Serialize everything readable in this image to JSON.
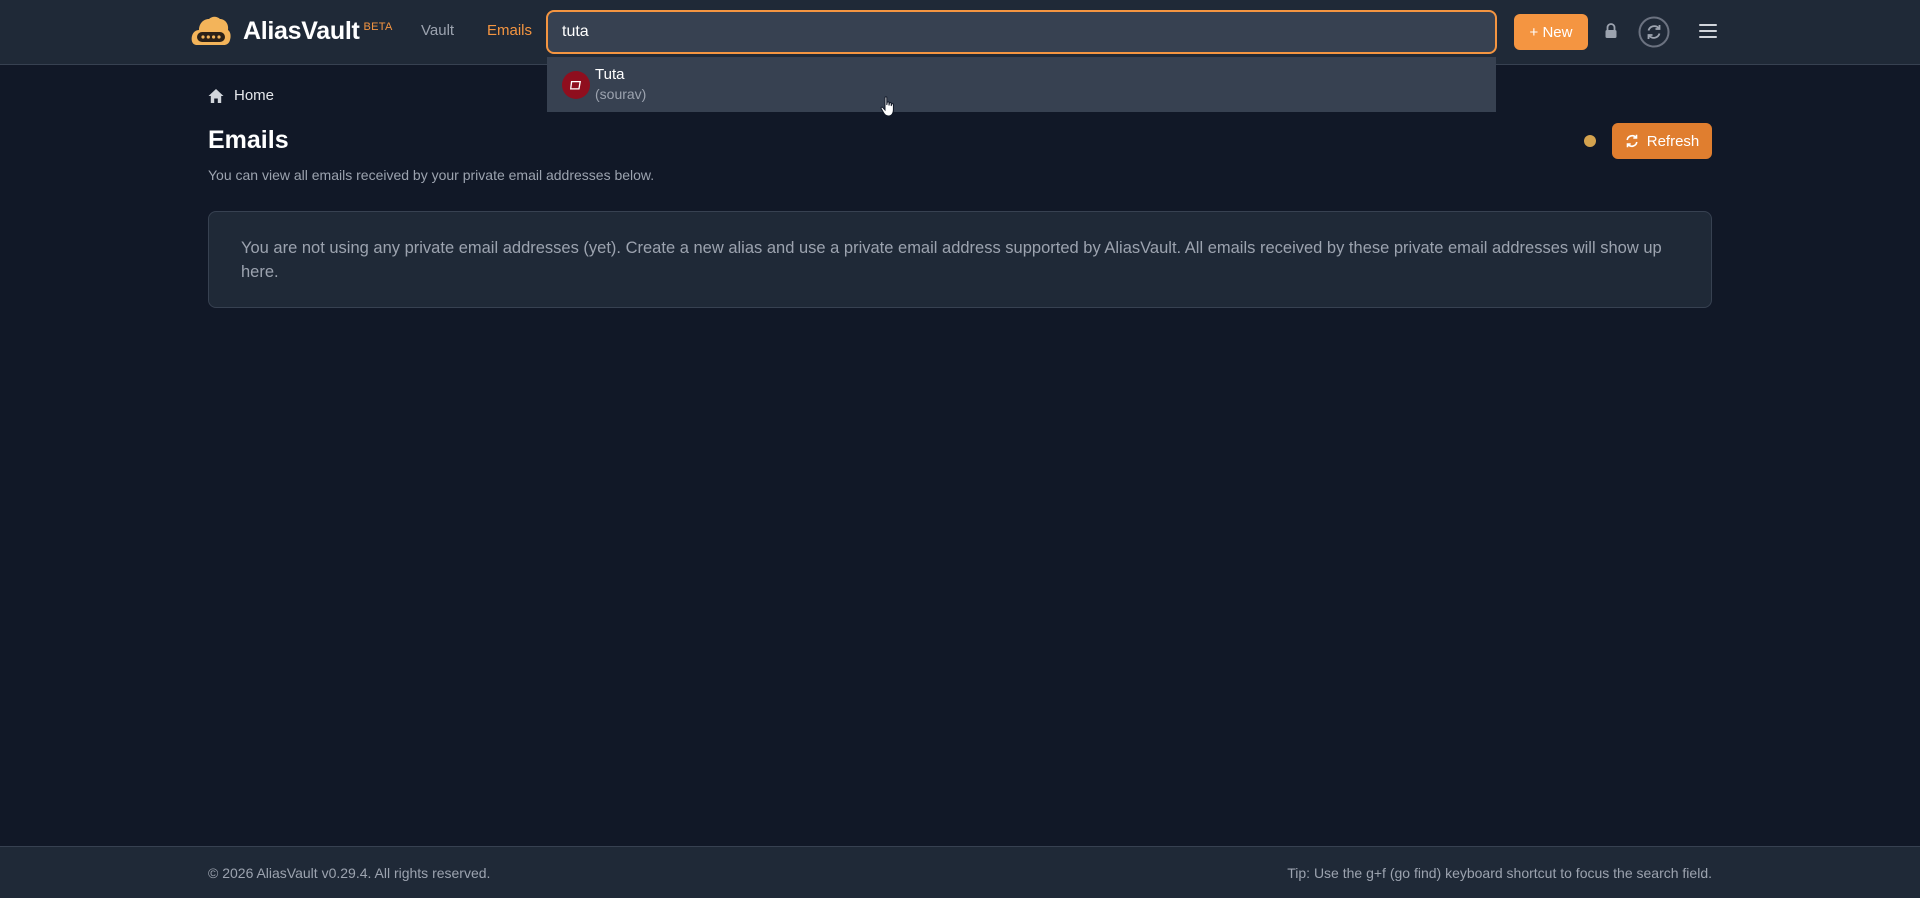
{
  "header": {
    "brand": "AliasVault",
    "badge": "BETA",
    "nav": {
      "vault": "Vault",
      "emails": "Emails"
    },
    "search_value": "tuta",
    "new_button": "+ New"
  },
  "search_results": [
    {
      "name": "Tuta",
      "username": "(sourav)"
    }
  ],
  "breadcrumb": {
    "home": "Home"
  },
  "page": {
    "title": "Emails",
    "subtitle": "You can view all emails received by your private email addresses below.",
    "refresh": "Refresh",
    "notice": "You are not using any private email addresses (yet). Create a new alias and use a private email address supported by AliasVault. All emails received by these private email addresses will show up here."
  },
  "footer": {
    "copyright": "© 2026 AliasVault v0.29.4. All rights reserved.",
    "tip": "Tip: Use the g+f (go find) keyboard shortcut to focus the search field."
  },
  "colors": {
    "accent": "#f49541",
    "background": "#111827",
    "surface": "#1f2937",
    "tuta_red": "#8f0e1e",
    "status_dot": "#d4a24e"
  }
}
